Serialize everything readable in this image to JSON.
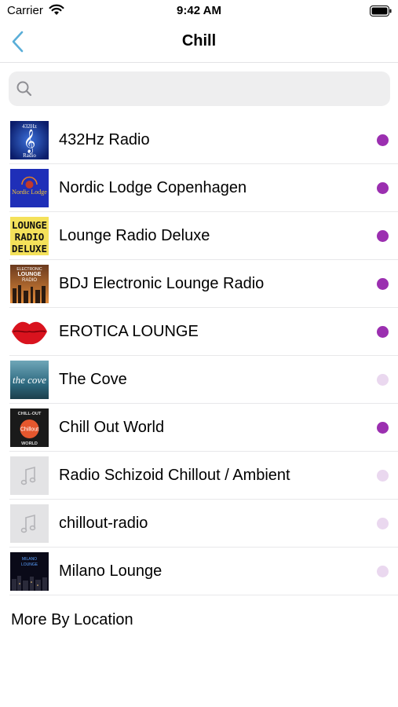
{
  "status_bar": {
    "carrier": "Carrier",
    "time": "9:42 AM"
  },
  "nav": {
    "title": "Chill",
    "back_icon": "chevron-left-icon",
    "accent_color": "#5aaed8"
  },
  "search": {
    "placeholder": "",
    "value": ""
  },
  "colors": {
    "active_dot": "#9b2fb0",
    "inactive_dot": "#ead8ef"
  },
  "stations": [
    {
      "name": "432Hz Radio",
      "artwork": "432hz",
      "active": true
    },
    {
      "name": "Nordic Lodge Copenhagen",
      "artwork": "nordic",
      "active": true
    },
    {
      "name": "Lounge Radio Deluxe",
      "artwork": "lounge",
      "active": true
    },
    {
      "name": "BDJ Electronic Lounge Radio",
      "artwork": "bdj",
      "active": true
    },
    {
      "name": "EROTICA LOUNGE",
      "artwork": "lips",
      "active": true
    },
    {
      "name": "The Cove",
      "artwork": "cove",
      "active": false
    },
    {
      "name": "Chill Out World",
      "artwork": "chillout",
      "active": true
    },
    {
      "name": "Radio Schizoid Chillout / Ambient",
      "artwork": "music-note-placeholder",
      "active": false
    },
    {
      "name": "chillout-radio",
      "artwork": "music-note-placeholder",
      "active": false
    },
    {
      "name": "Milano Lounge",
      "artwork": "milano",
      "active": false
    }
  ],
  "artwork_text": {
    "432hz_top": "432Hz",
    "432hz_bottom": "Radio",
    "nordic": "Nordic Lodge",
    "lounge": [
      "LOUNGE",
      "RADIO",
      "DELUXE"
    ],
    "bdj": [
      "ELECTRONIC",
      "LOUNGE",
      "RADIO"
    ],
    "cove_main": "the cove",
    "chillout_top": "CHILL-OUT",
    "chillout_mid": "Chillout",
    "chillout_bottom": "WORLD",
    "milano": [
      "MILANO",
      "LOUNGE"
    ]
  },
  "more_by_location": "More By Location"
}
